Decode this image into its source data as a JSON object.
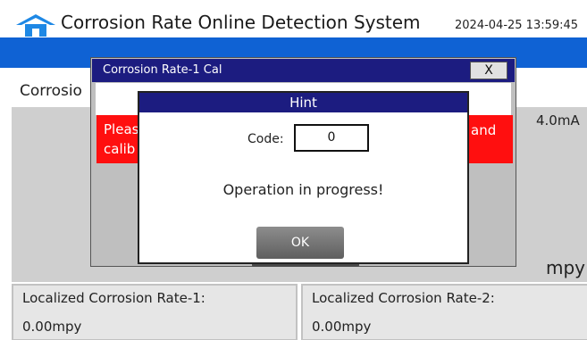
{
  "header": {
    "title": "Corrosion Rate Online Detection System",
    "datetime": "2024-04-25 13:59:45",
    "icon": "home-icon"
  },
  "page": {
    "heading": "Corrosio",
    "panel_value_right": "4.0mA",
    "panel_unit": "mpy",
    "bottom_left": {
      "label": "Localized Corrosion Rate-1:",
      "value": "0.00mpy"
    },
    "bottom_right": {
      "label": "Localized Corrosion Rate-2:",
      "value": "0.00mpy"
    }
  },
  "cal_dialog": {
    "title": "Corrosion Rate-1 Cal",
    "close_label": "X",
    "red_text_line1": "Pleas",
    "red_text_line2": "calib",
    "red_text_right": "and"
  },
  "hint_dialog": {
    "title": "Hint",
    "code_label": "Code:",
    "code_value": "0",
    "message": "Operation in progress!",
    "ok_label": "OK"
  },
  "colors": {
    "header_bar": "#0f62d4",
    "dialog_title": "#1c1c80",
    "warning": "#ff0f0f",
    "panel": "#cfcfcf",
    "home_icon": "#1e88e5"
  }
}
